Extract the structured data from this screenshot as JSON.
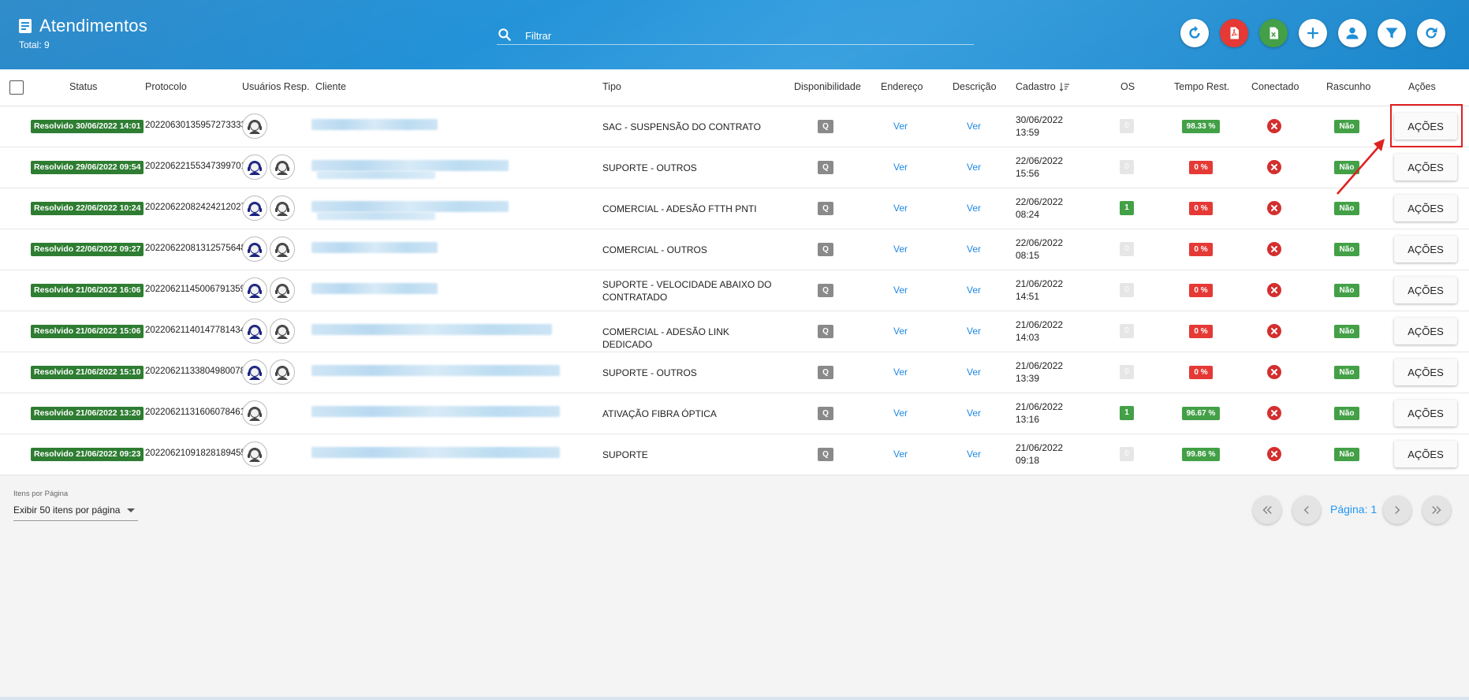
{
  "header": {
    "title": "Atendimentos",
    "total": "Total: 9",
    "search_placeholder": "Filtrar",
    "buttons": [
      "refresh-alt-icon",
      "pdf-icon",
      "excel-icon",
      "add-icon",
      "user-icon",
      "filter-icon",
      "reload-icon"
    ]
  },
  "table": {
    "columns": {
      "status": "Status",
      "protocolo": "Protocolo",
      "usuarios": "Usuários Resp.",
      "cliente": "Cliente",
      "tipo": "Tipo",
      "disponibilidade": "Disponibilidade",
      "endereco": "Endereço",
      "descricao": "Descrição",
      "cadastro": "Cadastro",
      "os": "OS",
      "tempo": "Tempo Rest.",
      "conectado": "Conectado",
      "rascunho": "Rascunho",
      "acoes": "Ações"
    },
    "rows": [
      {
        "status": "Resolvido 30/06/2022 14:01",
        "protocolo": "20220630135957273333",
        "avatars": 1,
        "tipo": "SAC - SUSPENSÃO DO CONTRATO",
        "disp": "Q",
        "endereco": "Ver",
        "descricao": "Ver",
        "cad_date": "30/06/2022",
        "cad_time": "13:59",
        "os": "0",
        "tempo": "98.33 %",
        "tempo_color": "green",
        "rascunho": "Não",
        "acoes": "AÇÕES"
      },
      {
        "status": "Resolvido 29/06/2022 09:54",
        "protocolo": "20220622155347399701",
        "avatars": 2,
        "tipo": "SUPORTE - OUTROS",
        "disp": "Q",
        "endereco": "Ver",
        "descricao": "Ver",
        "cad_date": "22/06/2022",
        "cad_time": "15:56",
        "os": "0",
        "tempo": "0 %",
        "tempo_color": "red",
        "rascunho": "Não",
        "acoes": "AÇÕES"
      },
      {
        "status": "Resolvido 22/06/2022 10:24",
        "protocolo": "20220622082424212027",
        "avatars": 2,
        "tipo": "COMERCIAL - ADESÃO FTTH PNTI",
        "disp": "Q",
        "endereco": "Ver",
        "descricao": "Ver",
        "cad_date": "22/06/2022",
        "cad_time": "08:24",
        "os": "1",
        "tempo": "0 %",
        "tempo_color": "red",
        "rascunho": "Não",
        "acoes": "AÇÕES"
      },
      {
        "status": "Resolvido 22/06/2022 09:27",
        "protocolo": "20220622081312575648",
        "avatars": 2,
        "tipo": "COMERCIAL - OUTROS",
        "disp": "Q",
        "endereco": "Ver",
        "descricao": "Ver",
        "cad_date": "22/06/2022",
        "cad_time": "08:15",
        "os": "0",
        "tempo": "0 %",
        "tempo_color": "red",
        "rascunho": "Não",
        "acoes": "AÇÕES"
      },
      {
        "status": "Resolvido 21/06/2022 16:06",
        "protocolo": "20220621145006791359",
        "avatars": 2,
        "tipo": "SUPORTE - VELOCIDADE ABAIXO DO CONTRATADO",
        "disp": "Q",
        "endereco": "Ver",
        "descricao": "Ver",
        "cad_date": "21/06/2022",
        "cad_time": "14:51",
        "os": "0",
        "tempo": "0 %",
        "tempo_color": "red",
        "rascunho": "Não",
        "acoes": "AÇÕES"
      },
      {
        "status": "Resolvido 21/06/2022 15:06",
        "protocolo": "20220621140147781434",
        "avatars": 2,
        "tipo": "COMERCIAL - ADESÃO LINK DEDICADO",
        "disp": "Q",
        "endereco": "Ver",
        "descricao": "Ver",
        "cad_date": "21/06/2022",
        "cad_time": "14:03",
        "os": "0",
        "tempo": "0 %",
        "tempo_color": "red",
        "rascunho": "Não",
        "acoes": "AÇÕES"
      },
      {
        "status": "Resolvido 21/06/2022 15:10",
        "protocolo": "20220621133804980078",
        "avatars": 2,
        "tipo": "SUPORTE - OUTROS",
        "disp": "Q",
        "endereco": "Ver",
        "descricao": "Ver",
        "cad_date": "21/06/2022",
        "cad_time": "13:39",
        "os": "0",
        "tempo": "0 %",
        "tempo_color": "red",
        "rascunho": "Não",
        "acoes": "AÇÕES"
      },
      {
        "status": "Resolvido 21/06/2022 13:20",
        "protocolo": "20220621131606078461",
        "avatars": 1,
        "tipo": "ATIVAÇÃO FIBRA ÓPTICA",
        "disp": "Q",
        "endereco": "Ver",
        "descricao": "Ver",
        "cad_date": "21/06/2022",
        "cad_time": "13:16",
        "os": "1",
        "tempo": "96.67 %",
        "tempo_color": "green",
        "rascunho": "Não",
        "acoes": "AÇÕES"
      },
      {
        "status": "Resolvido 21/06/2022 09:23",
        "protocolo": "20220621091828189455",
        "avatars": 1,
        "tipo": "SUPORTE",
        "disp": "Q",
        "endereco": "Ver",
        "descricao": "Ver",
        "cad_date": "21/06/2022",
        "cad_time": "09:18",
        "os": "0",
        "tempo": "99.86 %",
        "tempo_color": "green",
        "rascunho": "Não",
        "acoes": "AÇÕES"
      }
    ]
  },
  "footer": {
    "perpage_label": "Itens por Página",
    "perpage_value": "Exibir 50 itens por página",
    "pagina": "Página: 1"
  },
  "colors": {
    "header_blue": "#1e8fd6",
    "status_green": "#2e7d32",
    "link_blue": "#1e88e5",
    "alert_red": "#e53935"
  }
}
